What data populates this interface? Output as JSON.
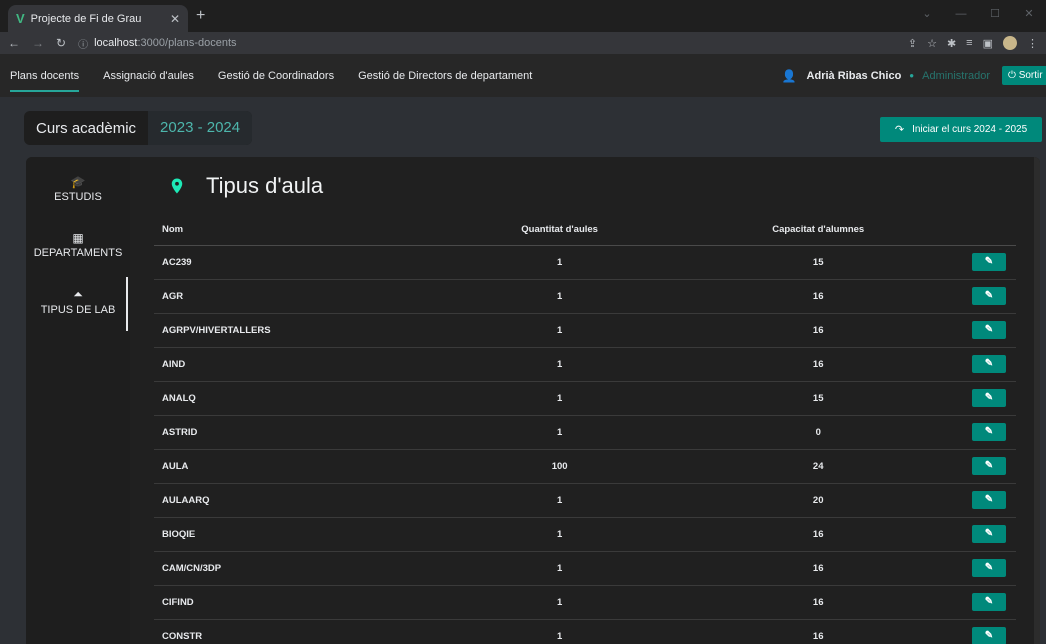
{
  "browser": {
    "tab_title": "Projecte de Fi de Grau",
    "url_host": "localhost",
    "url_path": ":3000/plans-docents"
  },
  "nav": {
    "links": [
      "Plans docents",
      "Assignació d'aules",
      "Gestió de Coordinadors",
      "Gestió de Directors de departament"
    ],
    "user_name": "Adrià Ribas Chico",
    "user_role": "Administrador",
    "logout_label": "Sortir"
  },
  "curs": {
    "label": "Curs acadèmic",
    "year": "2023 - 2024",
    "start_button": "Iniciar el curs 2024 - 2025"
  },
  "sidebar": {
    "items": [
      "ESTUDIS",
      "DEPARTAMENTS",
      "TIPUS DE LAB"
    ]
  },
  "main": {
    "title": "Tipus d'aula",
    "columns": [
      "Nom",
      "Quantitat d'aules",
      "Capacitat d'alumnes"
    ],
    "rows": [
      [
        "AC239",
        "1",
        "15"
      ],
      [
        "AGR",
        "1",
        "16"
      ],
      [
        "AGRPV/HIVERTALLERS",
        "1",
        "16"
      ],
      [
        "AIND",
        "1",
        "16"
      ],
      [
        "ANALQ",
        "1",
        "15"
      ],
      [
        "ASTRID",
        "1",
        "0"
      ],
      [
        "AULA",
        "100",
        "24"
      ],
      [
        "AULAARQ",
        "1",
        "20"
      ],
      [
        "BIOQIE",
        "1",
        "16"
      ],
      [
        "CAM/CN/3DP",
        "1",
        "16"
      ],
      [
        "CIFIND",
        "1",
        "16"
      ],
      [
        "CONSTR",
        "1",
        "16"
      ]
    ]
  },
  "colors": {
    "accent": "#00897b",
    "teal_text": "#4db6ac"
  }
}
